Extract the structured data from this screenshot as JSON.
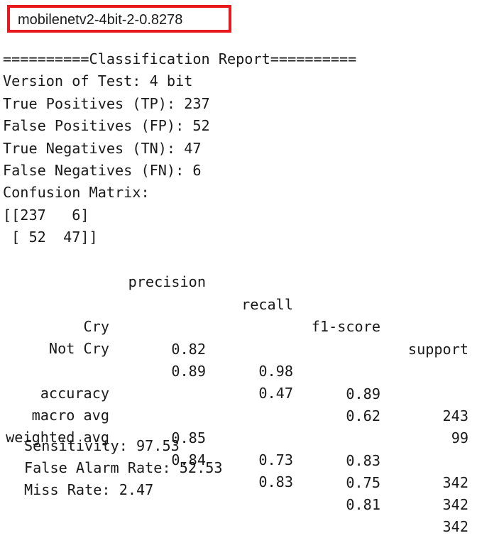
{
  "title": "mobilenetv2-4bit-2-0.8278",
  "report": {
    "header": "==========Classification Report==========",
    "lines": [
      "Version of Test: 4 bit",
      "True Positives (TP): 237",
      "False Positives (FP): 52",
      "True Negatives (TN): 47",
      "False Negatives (FN): 6",
      "Confusion Matrix:",
      "[[237   6]",
      " [ 52  47]]"
    ]
  },
  "table": {
    "columns": [
      "precision",
      "recall",
      "f1-score",
      "support"
    ],
    "rows": [
      {
        "label": "Cry",
        "values": [
          "0.82",
          "0.98",
          "0.89",
          "243"
        ]
      },
      {
        "label": "Not Cry",
        "values": [
          "0.89",
          "0.47",
          "0.62",
          "99"
        ]
      },
      {
        "label": "accuracy",
        "values": [
          "",
          "",
          "0.83",
          "342"
        ]
      },
      {
        "label": "macro avg",
        "values": [
          "0.85",
          "0.73",
          "0.75",
          "342"
        ]
      },
      {
        "label": "weighted avg",
        "values": [
          "0.84",
          "0.83",
          "0.81",
          "342"
        ]
      }
    ]
  },
  "metrics": [
    "Sensitivity: 97.53",
    "False Alarm Rate: 52.53",
    "Miss Rate: 2.47"
  ]
}
